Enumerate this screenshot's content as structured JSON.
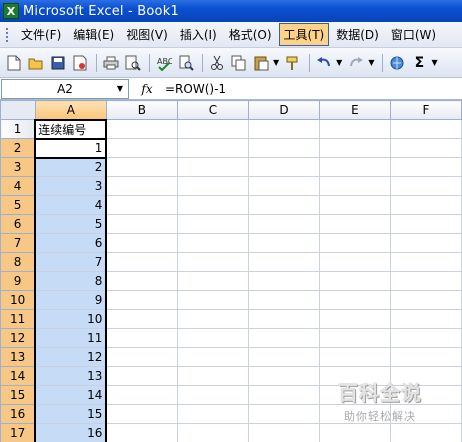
{
  "window": {
    "title": "Microsoft Excel - Book1",
    "app_icon_letter": "X"
  },
  "menu": {
    "items": [
      {
        "label": "文件(F)"
      },
      {
        "label": "编辑(E)"
      },
      {
        "label": "视图(V)"
      },
      {
        "label": "插入(I)"
      },
      {
        "label": "格式(O)"
      },
      {
        "label": "工具(T)",
        "active": true
      },
      {
        "label": "数据(D)"
      },
      {
        "label": "窗口(W)"
      }
    ]
  },
  "toolbar": {
    "buttons": [
      "new-icon",
      "open-icon",
      "save-icon",
      "permission-icon",
      "print-icon",
      "print-preview-icon",
      "spelling-icon",
      "research-icon",
      "cut-icon",
      "copy-icon",
      "paste-icon",
      "format-painter-icon",
      "undo-icon",
      "redo-icon",
      "hyperlink-icon",
      "autosum-icon"
    ],
    "autosum_glyph": "Σ"
  },
  "formula_bar": {
    "name_box": "A2",
    "fx_label": "fx",
    "formula": "=ROW()-1"
  },
  "sheet": {
    "columns": [
      "A",
      "B",
      "C",
      "D",
      "E",
      "F"
    ],
    "rows": [
      {
        "n": "1",
        "a": "连续编号"
      },
      {
        "n": "2",
        "a": "1"
      },
      {
        "n": "3",
        "a": "2"
      },
      {
        "n": "4",
        "a": "3"
      },
      {
        "n": "5",
        "a": "4"
      },
      {
        "n": "6",
        "a": "5"
      },
      {
        "n": "7",
        "a": "6"
      },
      {
        "n": "8",
        "a": "7"
      },
      {
        "n": "9",
        "a": "8"
      },
      {
        "n": "10",
        "a": "9"
      },
      {
        "n": "11",
        "a": "10"
      },
      {
        "n": "12",
        "a": "11"
      },
      {
        "n": "13",
        "a": "12"
      },
      {
        "n": "14",
        "a": "13"
      },
      {
        "n": "15",
        "a": "14"
      },
      {
        "n": "16",
        "a": "15"
      },
      {
        "n": "17",
        "a": "16"
      }
    ],
    "active_cell": "A2",
    "selected_column": "A"
  },
  "watermark": {
    "logo": "百科全说",
    "sub": "助你轻松解决"
  },
  "colors": {
    "title_bar": "#0a4fd0",
    "selection": "#c6dcf6",
    "header_selected": "#f7c785"
  }
}
